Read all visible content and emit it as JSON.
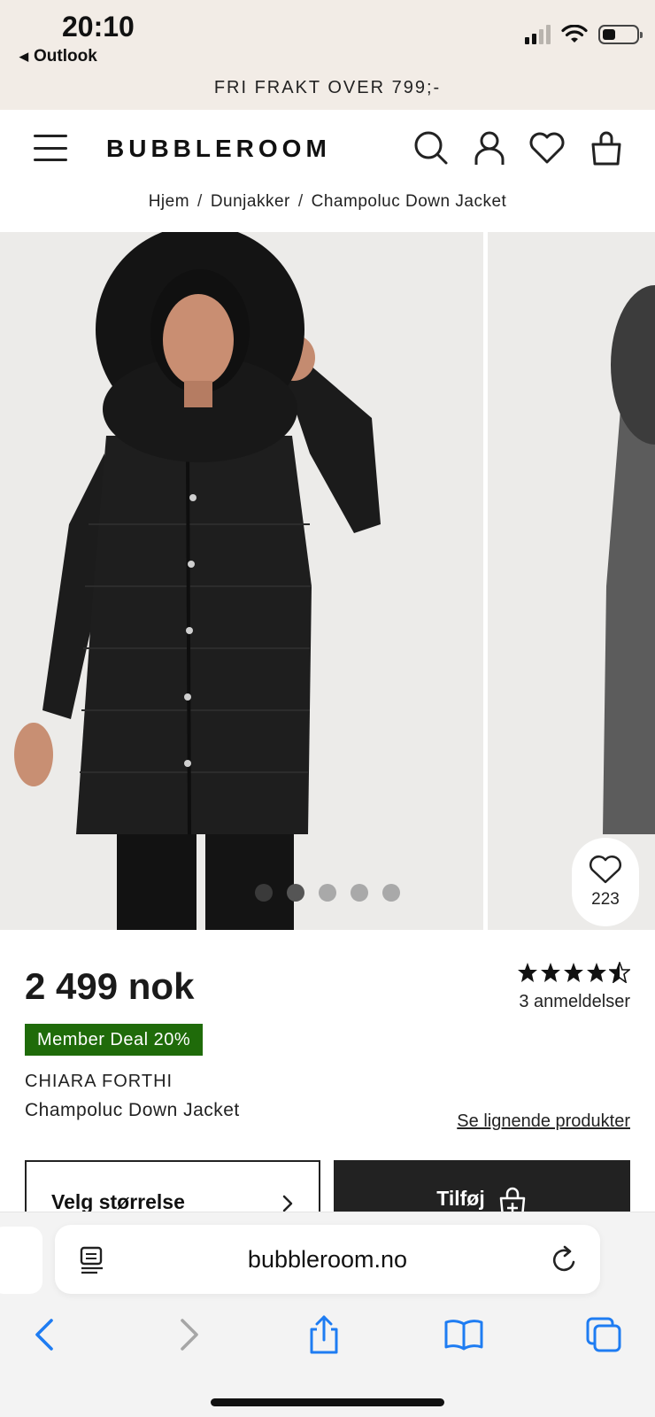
{
  "status_bar": {
    "time": "20:10",
    "back_app": "Outlook"
  },
  "banner": {
    "text": "FRI FRAKT OVER 799;-"
  },
  "header": {
    "logo": "BUBBLEROOM"
  },
  "breadcrumb": {
    "items": [
      "Hjem",
      "Dunjakker",
      "Champoluc Down Jacket"
    ]
  },
  "gallery": {
    "wishlist_count": "223",
    "slide_count": 5,
    "active_slide": 2
  },
  "product": {
    "price": "2 499 nok",
    "rating": 4.5,
    "reviews": "3 anmeldelser",
    "badge": "Member Deal 20%",
    "brand": "CHIARA FORTHI",
    "name": "Champoluc Down Jacket",
    "similar_link": "Se lignende produkter",
    "size_button": "Velg størrelse",
    "add_button": "Tilføj"
  },
  "browser": {
    "url": "bubbleroom.no"
  },
  "colors": {
    "member_badge": "#1f6b0a",
    "banner_bg": "#f2ece6",
    "ios_blue": "#1e7cf2"
  },
  "icons": {
    "header": [
      "menu-icon",
      "search-icon",
      "account-icon",
      "heart-icon",
      "bag-icon"
    ],
    "browser": [
      "reader-icon",
      "reload-icon",
      "back-icon",
      "forward-icon",
      "share-icon",
      "bookmarks-icon",
      "tabs-icon"
    ]
  }
}
